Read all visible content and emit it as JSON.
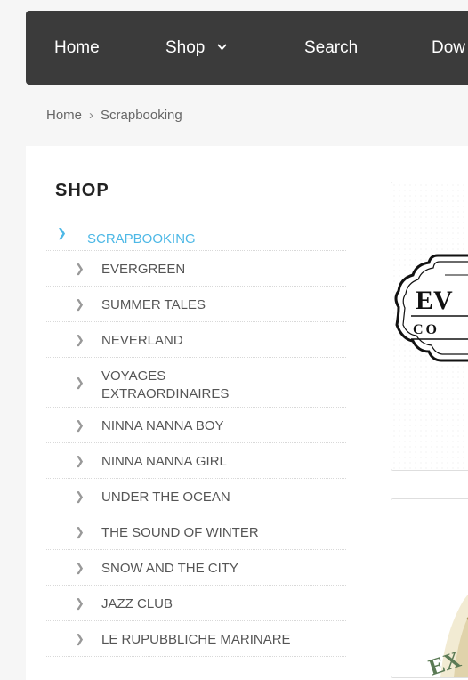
{
  "nav": {
    "home": "Home",
    "shop": "Shop",
    "search": "Search",
    "download": "Dow"
  },
  "breadcrumb": {
    "home": "Home",
    "separator": "›",
    "current": "Scrapbooking"
  },
  "sidebar": {
    "title": "SHOP",
    "items": [
      {
        "label": "SCRAPBOOKING"
      },
      {
        "label": "EVERGREEN"
      },
      {
        "label": "SUMMER TALES"
      },
      {
        "label": "NEVERLAND"
      },
      {
        "label": "VOYAGES EXTRAORDINAIRES"
      },
      {
        "label": "NINNA NANNA BOY"
      },
      {
        "label": "NINNA NANNA GIRL"
      },
      {
        "label": "UNDER THE OCEAN"
      },
      {
        "label": "THE SOUND OF WINTER"
      },
      {
        "label": "SNOW AND THE CITY"
      },
      {
        "label": "JAZZ CLUB"
      },
      {
        "label": "LE RUPUBBLICHE MARINARE"
      }
    ]
  },
  "products": {
    "card1_logo_text": "EV",
    "card1_logo_sub": "CO",
    "card2_logo_text": "EX"
  },
  "colors": {
    "navbar": "#3b3b3b",
    "accent": "#4db8e6",
    "background": "#f6f6f6"
  }
}
